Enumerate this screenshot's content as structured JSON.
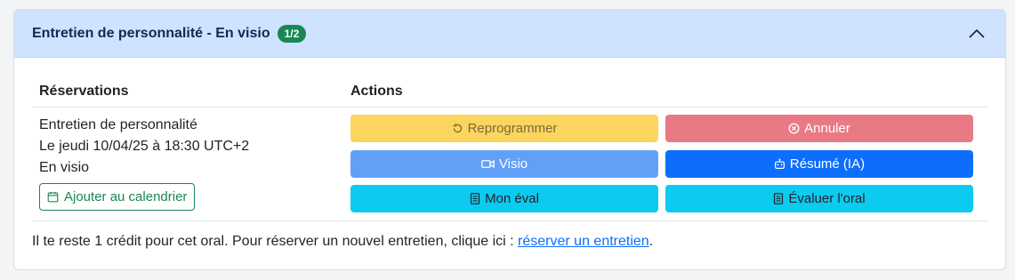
{
  "header": {
    "title": "Entretien de personnalité - En visio",
    "badge": "1/2",
    "collapse_icon": "chevron-up-icon"
  },
  "table": {
    "col_reservations": "Réservations",
    "col_actions": "Actions"
  },
  "reservation": {
    "name": "Entretien de personnalité",
    "datetime": "Le jeudi 10/04/25 à 18:30 UTC+2",
    "mode": "En visio",
    "calendar_button": "Ajouter au calendrier"
  },
  "actions": {
    "reschedule": "Reprogrammer",
    "cancel": "Annuler",
    "visio": "Visio",
    "summary": "Résumé (IA)",
    "my_eval": "Mon éval",
    "evaluate": "Évaluer l'oral"
  },
  "footer": {
    "text": "Il te reste 1 crédit pour cet oral. Pour réserver un nouvel entretien, clique ici : ",
    "link": "réserver un entretien",
    "suffix": "."
  },
  "colors": {
    "header_bg": "#cfe2ff",
    "badge_bg": "#198754",
    "reschedule_bg": "#fcd55f",
    "cancel_bg": "#e97a85",
    "visio_bg": "#62a0f8",
    "summary_bg": "#0d6efd",
    "eval_bg": "#0dcaf0"
  }
}
